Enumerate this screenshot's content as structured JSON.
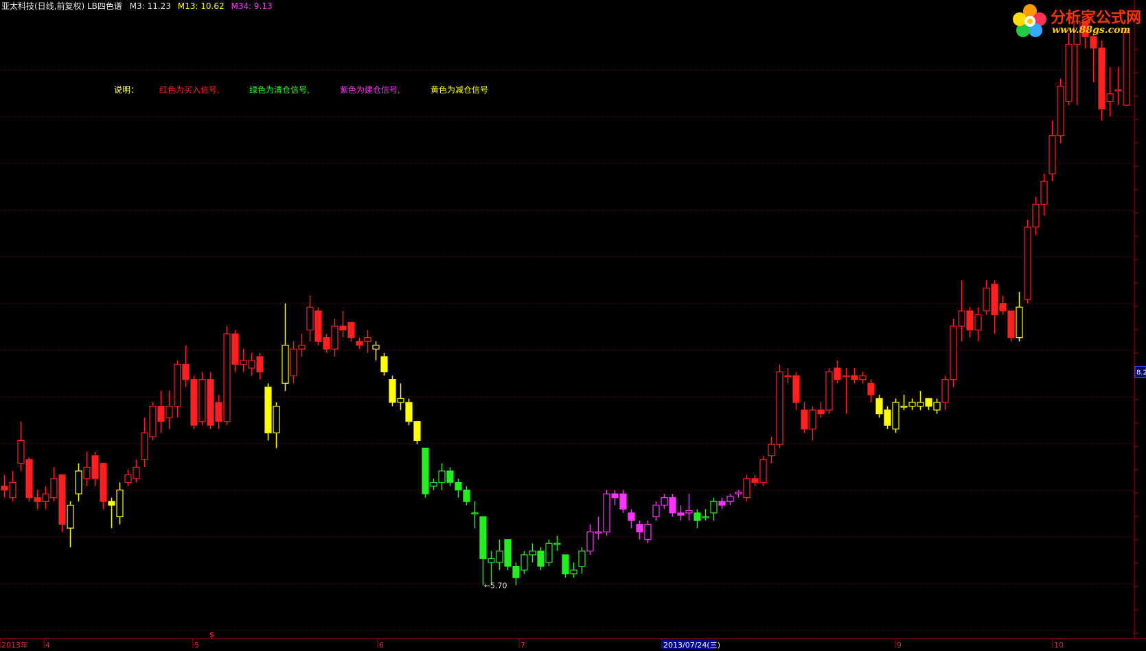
{
  "header": {
    "title": "亚太科技(日线,前复权) LB四色谱",
    "m3": "M3: 11.23",
    "m13": "M13: 10.62",
    "m34": "M34: 9.13"
  },
  "logo": {
    "name": "分析家公式网",
    "url": "www.88gs.com"
  },
  "legend": {
    "intro": "说明：",
    "items": [
      {
        "text": "红色为买入信号,",
        "color": "#ff2020"
      },
      {
        "text": "绿色为清仓信号,",
        "color": "#22ff22"
      },
      {
        "text": "紫色为建仓信号,",
        "color": "#ff33ff"
      },
      {
        "text": "黄色为减仓信号",
        "color": "#ffff00"
      }
    ]
  },
  "colors": {
    "red": "#ff2020",
    "green": "#22ee22",
    "magenta": "#ff33ff",
    "yellow": "#ffff00",
    "grid": "#8c0000",
    "axis": "#aa0000"
  },
  "chart_data": {
    "type": "candlestick",
    "ylim": [
      5.0,
      13.2
    ],
    "min_label": "←5.70",
    "price_tag": "8.2",
    "x_tick_labels": [
      "2013年",
      "4",
      "5",
      "6",
      "7",
      "2013/07/24(三)",
      "9",
      "10"
    ],
    "x_marker": "$",
    "colors": {
      "R": "red",
      "G": "green",
      "M": "magenta",
      "Y": "yellow"
    },
    "candles": [
      [
        7.0,
        6.95,
        7.15,
        6.85,
        "R"
      ],
      [
        6.85,
        7.05,
        7.2,
        6.8,
        "R"
      ],
      [
        7.3,
        7.6,
        7.85,
        7.2,
        "R"
      ],
      [
        7.35,
        6.85,
        7.38,
        6.8,
        "R"
      ],
      [
        6.85,
        6.8,
        6.95,
        6.7,
        "R"
      ],
      [
        6.8,
        6.9,
        7.0,
        6.7,
        "R"
      ],
      [
        6.85,
        7.1,
        7.25,
        6.8,
        "R"
      ],
      [
        7.15,
        6.5,
        7.15,
        6.4,
        "R"
      ],
      [
        6.45,
        6.75,
        6.8,
        6.2,
        "Y"
      ],
      [
        6.9,
        7.2,
        7.3,
        6.8,
        "Y"
      ],
      [
        7.1,
        7.25,
        7.45,
        7.0,
        "R"
      ],
      [
        7.4,
        7.1,
        7.45,
        7.0,
        "R"
      ],
      [
        7.3,
        6.8,
        7.3,
        6.7,
        "R"
      ],
      [
        6.8,
        6.75,
        6.85,
        6.45,
        "Y"
      ],
      [
        6.6,
        6.95,
        7.05,
        6.5,
        "Y"
      ],
      [
        7.05,
        7.15,
        7.22,
        7.0,
        "R"
      ],
      [
        7.1,
        7.25,
        7.35,
        7.05,
        "R"
      ],
      [
        7.35,
        7.7,
        7.9,
        7.25,
        "R"
      ],
      [
        7.65,
        8.05,
        8.1,
        7.6,
        "R"
      ],
      [
        8.05,
        7.85,
        8.25,
        7.7,
        "R"
      ],
      [
        7.9,
        8.05,
        8.25,
        7.75,
        "R"
      ],
      [
        8.05,
        8.6,
        8.65,
        7.9,
        "R"
      ],
      [
        8.6,
        8.4,
        8.85,
        8.3,
        "R"
      ],
      [
        8.4,
        7.8,
        8.45,
        7.75,
        "R"
      ],
      [
        7.85,
        8.4,
        8.5,
        7.8,
        "R"
      ],
      [
        8.4,
        7.8,
        8.5,
        7.75,
        "R"
      ],
      [
        8.1,
        7.85,
        8.2,
        7.75,
        "R"
      ],
      [
        7.85,
        9.0,
        9.1,
        7.8,
        "R"
      ],
      [
        9.0,
        8.6,
        9.05,
        8.5,
        "R"
      ],
      [
        8.6,
        8.65,
        8.8,
        8.5,
        "R"
      ],
      [
        8.55,
        8.65,
        8.75,
        8.45,
        "R"
      ],
      [
        8.7,
        8.5,
        8.75,
        8.4,
        "R"
      ],
      [
        8.3,
        7.7,
        8.35,
        7.6,
        "Y"
      ],
      [
        7.7,
        8.05,
        8.1,
        7.5,
        "Y"
      ],
      [
        8.35,
        8.85,
        9.4,
        8.25,
        "Y"
      ],
      [
        8.45,
        8.8,
        8.9,
        8.35,
        "R"
      ],
      [
        8.8,
        8.85,
        9.0,
        8.7,
        "R"
      ],
      [
        9.05,
        9.35,
        9.5,
        8.9,
        "R"
      ],
      [
        9.3,
        8.9,
        9.35,
        8.85,
        "R"
      ],
      [
        8.95,
        8.8,
        9.0,
        8.75,
        "R"
      ],
      [
        8.8,
        9.1,
        9.2,
        8.7,
        "R"
      ],
      [
        9.1,
        9.05,
        9.3,
        8.95,
        "R"
      ],
      [
        9.15,
        8.95,
        9.15,
        8.9,
        "R"
      ],
      [
        8.9,
        8.85,
        8.95,
        8.8,
        "R"
      ],
      [
        8.9,
        8.95,
        9.05,
        8.75,
        "R"
      ],
      [
        8.8,
        8.85,
        8.9,
        8.65,
        "Y"
      ],
      [
        8.7,
        8.5,
        8.75,
        8.45,
        "Y"
      ],
      [
        8.4,
        8.1,
        8.45,
        8.05,
        "Y"
      ],
      [
        8.1,
        8.15,
        8.35,
        8.0,
        "Y"
      ],
      [
        8.1,
        7.85,
        8.15,
        7.8,
        "Y"
      ],
      [
        7.85,
        7.6,
        7.85,
        7.55,
        "Y"
      ],
      [
        7.5,
        6.9,
        7.5,
        6.85,
        "G"
      ],
      [
        7.0,
        7.05,
        7.1,
        6.95,
        "G"
      ],
      [
        7.05,
        7.2,
        7.3,
        6.95,
        "G"
      ],
      [
        7.2,
        7.05,
        7.25,
        7.0,
        "G"
      ],
      [
        7.05,
        6.95,
        7.1,
        6.85,
        "G"
      ],
      [
        6.95,
        6.8,
        7.0,
        6.75,
        "G"
      ],
      [
        6.65,
        6.65,
        6.8,
        6.45,
        "G"
      ],
      [
        6.6,
        6.05,
        6.6,
        5.7,
        "G"
      ],
      [
        6.0,
        6.05,
        6.15,
        5.7,
        "G"
      ],
      [
        6.0,
        6.15,
        6.3,
        5.9,
        "G"
      ],
      [
        6.3,
        5.95,
        6.3,
        5.9,
        "G"
      ],
      [
        5.95,
        5.8,
        6.0,
        5.7,
        "G"
      ],
      [
        5.9,
        6.1,
        6.15,
        5.85,
        "G"
      ],
      [
        6.1,
        6.15,
        6.25,
        6.0,
        "G"
      ],
      [
        6.15,
        5.95,
        6.2,
        5.9,
        "G"
      ],
      [
        6.0,
        6.25,
        6.3,
        5.95,
        "G"
      ],
      [
        6.25,
        6.25,
        6.35,
        6.15,
        "G"
      ],
      [
        6.1,
        5.85,
        6.1,
        5.8,
        "G"
      ],
      [
        5.85,
        5.9,
        6.0,
        5.8,
        "G"
      ],
      [
        5.95,
        6.15,
        6.2,
        5.85,
        "G"
      ],
      [
        6.15,
        6.4,
        6.5,
        6.1,
        "M"
      ],
      [
        6.4,
        6.4,
        6.6,
        6.3,
        "M"
      ],
      [
        6.4,
        6.9,
        6.95,
        6.35,
        "M"
      ],
      [
        6.9,
        6.85,
        6.95,
        6.75,
        "M"
      ],
      [
        6.9,
        6.7,
        6.95,
        6.65,
        "M"
      ],
      [
        6.65,
        6.55,
        6.7,
        6.45,
        "M"
      ],
      [
        6.5,
        6.4,
        6.55,
        6.3,
        "M"
      ],
      [
        6.3,
        6.5,
        6.55,
        6.25,
        "M"
      ],
      [
        6.6,
        6.75,
        6.8,
        6.55,
        "M"
      ],
      [
        6.75,
        6.85,
        6.9,
        6.7,
        "M"
      ],
      [
        6.85,
        6.65,
        6.9,
        6.6,
        "M"
      ],
      [
        6.65,
        6.62,
        6.75,
        6.55,
        "M"
      ],
      [
        6.65,
        6.68,
        6.9,
        6.55,
        "M"
      ],
      [
        6.65,
        6.55,
        6.7,
        6.45,
        "G"
      ],
      [
        6.6,
        6.6,
        6.7,
        6.55,
        "G"
      ],
      [
        6.65,
        6.8,
        6.85,
        6.55,
        "G"
      ],
      [
        6.8,
        6.75,
        6.85,
        6.7,
        "M"
      ],
      [
        6.8,
        6.87,
        6.9,
        6.75,
        "M"
      ],
      [
        6.9,
        6.92,
        6.95,
        6.85,
        "M"
      ],
      [
        6.85,
        7.1,
        7.15,
        6.8,
        "R"
      ],
      [
        7.1,
        7.05,
        7.15,
        7.0,
        "R"
      ],
      [
        7.05,
        7.35,
        7.4,
        7.0,
        "R"
      ],
      [
        7.4,
        7.55,
        7.65,
        7.3,
        "R"
      ],
      [
        7.55,
        8.5,
        8.6,
        7.5,
        "R"
      ],
      [
        8.45,
        8.45,
        8.55,
        8.35,
        "R"
      ],
      [
        8.45,
        8.1,
        8.5,
        8.0,
        "R"
      ],
      [
        8.0,
        7.75,
        8.1,
        7.7,
        "R"
      ],
      [
        7.75,
        8.0,
        8.05,
        7.6,
        "R"
      ],
      [
        8.0,
        7.95,
        8.1,
        7.9,
        "R"
      ],
      [
        8.0,
        8.5,
        8.55,
        7.95,
        "R"
      ],
      [
        8.55,
        8.4,
        8.65,
        8.35,
        "R"
      ],
      [
        8.45,
        8.45,
        8.55,
        7.95,
        "R"
      ],
      [
        8.45,
        8.4,
        8.55,
        8.35,
        "R"
      ],
      [
        8.4,
        8.45,
        8.5,
        8.35,
        "R"
      ],
      [
        8.35,
        8.2,
        8.4,
        8.1,
        "R"
      ],
      [
        8.15,
        7.95,
        8.2,
        7.9,
        "Y"
      ],
      [
        8.0,
        7.8,
        8.05,
        7.75,
        "Y"
      ],
      [
        7.75,
        8.1,
        8.15,
        7.7,
        "Y"
      ],
      [
        8.05,
        8.05,
        8.2,
        8.0,
        "Y"
      ],
      [
        8.05,
        8.1,
        8.15,
        8.0,
        "Y"
      ],
      [
        8.05,
        8.1,
        8.25,
        8.0,
        "Y"
      ],
      [
        8.15,
        8.05,
        8.15,
        8.0,
        "Y"
      ],
      [
        8.0,
        8.1,
        8.15,
        7.95,
        "Y"
      ],
      [
        8.1,
        8.4,
        8.45,
        8.0,
        "R"
      ],
      [
        8.4,
        9.1,
        9.2,
        8.3,
        "R"
      ],
      [
        9.1,
        9.3,
        9.7,
        8.9,
        "R"
      ],
      [
        9.3,
        9.05,
        9.35,
        8.95,
        "R"
      ],
      [
        9.05,
        9.25,
        9.35,
        8.9,
        "R"
      ],
      [
        9.3,
        9.6,
        9.7,
        9.25,
        "R"
      ],
      [
        9.65,
        9.25,
        9.7,
        9.0,
        "R"
      ],
      [
        9.4,
        9.3,
        9.5,
        9.25,
        "R"
      ],
      [
        9.3,
        8.95,
        9.3,
        8.9,
        "R"
      ],
      [
        8.95,
        9.35,
        9.55,
        8.9,
        "Y"
      ],
      [
        9.45,
        10.4,
        10.5,
        9.4,
        "R"
      ],
      [
        10.4,
        10.7,
        10.8,
        10.3,
        "R"
      ],
      [
        10.7,
        11.0,
        11.1,
        10.55,
        "R"
      ],
      [
        11.1,
        11.6,
        11.8,
        11.0,
        "R"
      ],
      [
        11.6,
        12.25,
        12.35,
        11.5,
        "R"
      ],
      [
        12.05,
        12.8,
        12.95,
        12.0,
        "R"
      ],
      [
        12.8,
        13.1,
        13.15,
        12.0,
        "R"
      ],
      [
        13.1,
        12.9,
        13.1,
        12.75,
        "R"
      ],
      [
        12.9,
        12.75,
        12.95,
        12.3,
        "R"
      ],
      [
        12.75,
        11.95,
        12.85,
        11.8,
        "R"
      ],
      [
        12.05,
        12.15,
        12.5,
        11.85,
        "R"
      ],
      [
        12.2,
        12.2,
        12.5,
        12.0,
        "R"
      ],
      [
        12.0,
        12.95,
        13.0,
        12.0,
        "R"
      ]
    ]
  }
}
